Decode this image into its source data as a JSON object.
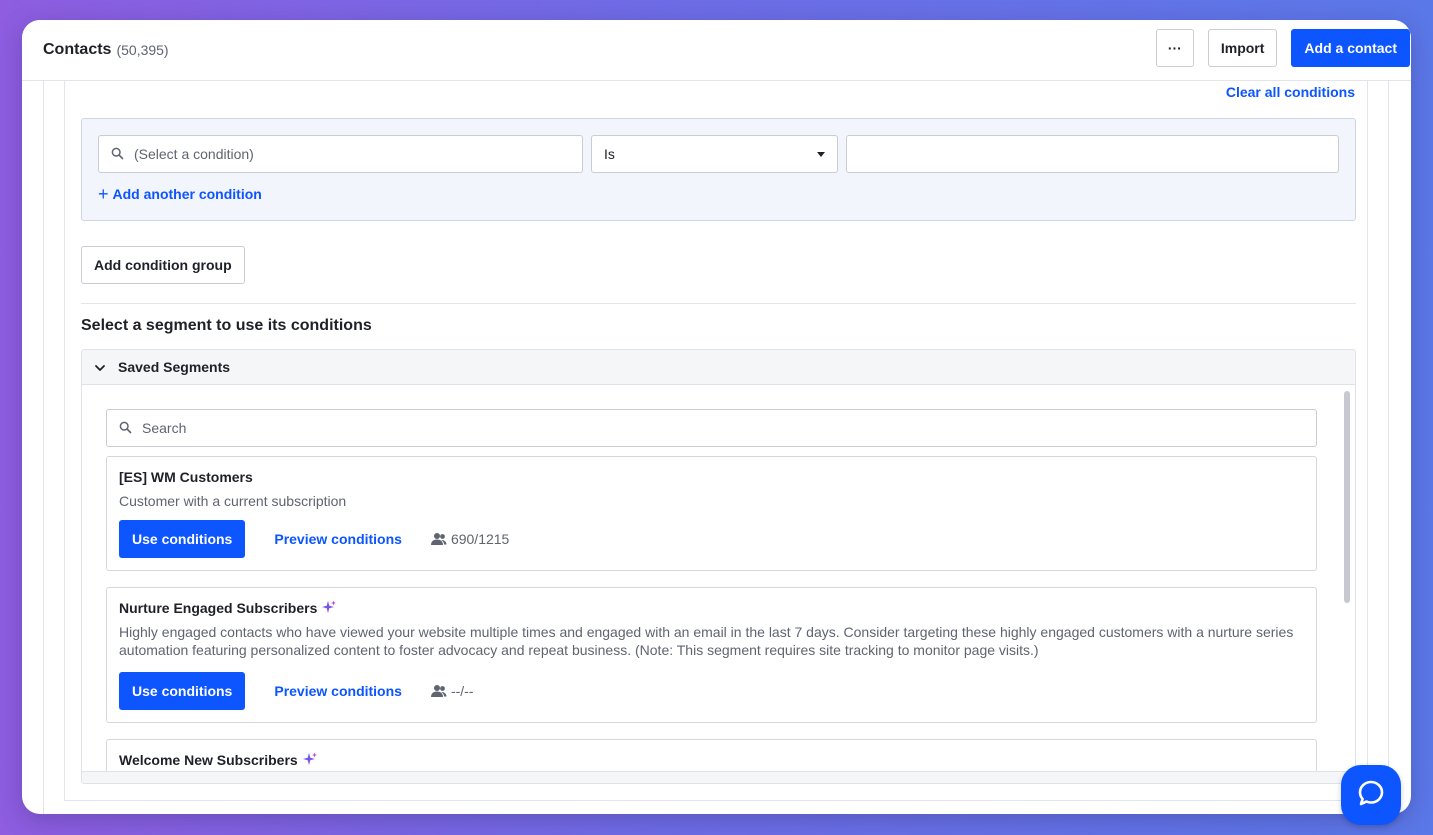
{
  "header": {
    "title": "Contacts",
    "count": "(50,395)",
    "more_label": "···",
    "import_label": "Import",
    "add_contact_label": "Add a contact"
  },
  "conditions": {
    "clear_all_label": "Clear all conditions",
    "condition_placeholder": "(Select a condition)",
    "operator_value": "Is",
    "value_field": "",
    "add_another_label": "Add another condition",
    "add_group_label": "Add condition group"
  },
  "segments": {
    "heading": "Select a segment to use its conditions",
    "panel_title": "Saved Segments",
    "search_placeholder": "Search",
    "items": [
      {
        "title": "[ES] WM Customers",
        "description": "Customer with a current subscription",
        "use_label": "Use conditions",
        "preview_label": "Preview conditions",
        "count": "690/1215",
        "ai_generated": false
      },
      {
        "title": "Nurture Engaged Subscribers",
        "description": "Highly engaged contacts who have viewed your website multiple times and engaged with an email in the last 7 days. Consider targeting these highly engaged customers with a nurture series automation featuring personalized content to foster advocacy and repeat business. (Note: This segment requires site tracking to monitor page visits.)",
        "use_label": "Use conditions",
        "preview_label": "Preview conditions",
        "count": "--/--",
        "ai_generated": true
      },
      {
        "title": "Welcome New Subscribers",
        "ai_generated": true
      }
    ]
  },
  "icons": {
    "search": "search-icon",
    "dropdown": "caret-down-icon",
    "add": "plus-icon",
    "collapse": "chevron-down-icon",
    "contacts": "people-icon",
    "ai": "sparkle-icon",
    "help": "chat-help-icon"
  },
  "colors": {
    "accent": "#0c55ff",
    "condition_box_bg": "#f2f5fb",
    "background_gradient_start": "#8e5de0",
    "background_gradient_end": "#5b78e8"
  }
}
